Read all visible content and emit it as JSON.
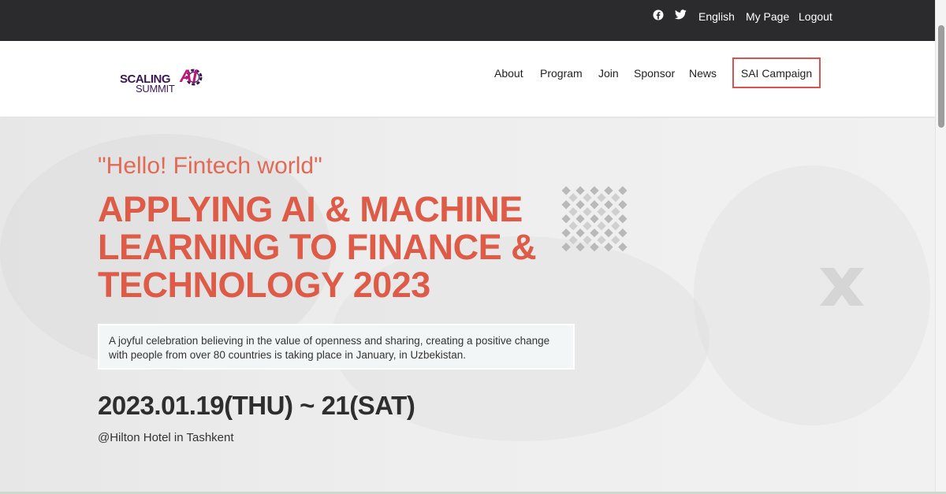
{
  "topbar": {
    "social": [
      {
        "name": "facebook-icon"
      },
      {
        "name": "twitter-icon"
      }
    ],
    "language": "English",
    "my_page": "My Page",
    "logout": "Logout"
  },
  "logo": {
    "scaling": "SCALING",
    "ai": "AI",
    "summit": "SUMMIT"
  },
  "nav": {
    "items": [
      "About",
      "Program",
      "Join",
      "Sponsor",
      "News"
    ],
    "campaign": "SAI Campaign"
  },
  "hero": {
    "tagline": "\"Hello! Fintech world\"",
    "headline_lines": [
      "APPLYING AI & MACHINE",
      "LEARNING TO FINANCE &",
      "TECHNOLOGY 2023"
    ],
    "description_lines": [
      "A joyful celebration believing in the value of openness and sharing, creating a positive change",
      "with people from over 80 countries is taking place in January, in Uzbekistan."
    ],
    "date": "2023.01.19(THU) ~ 21(SAT)",
    "venue": "@Hilton Hotel in Tashkent"
  },
  "colors": {
    "accent": "#dd5b47",
    "topbar": "#2b2b2d",
    "logo_primary": "#3b1750",
    "logo_ai": "#c1157a"
  }
}
